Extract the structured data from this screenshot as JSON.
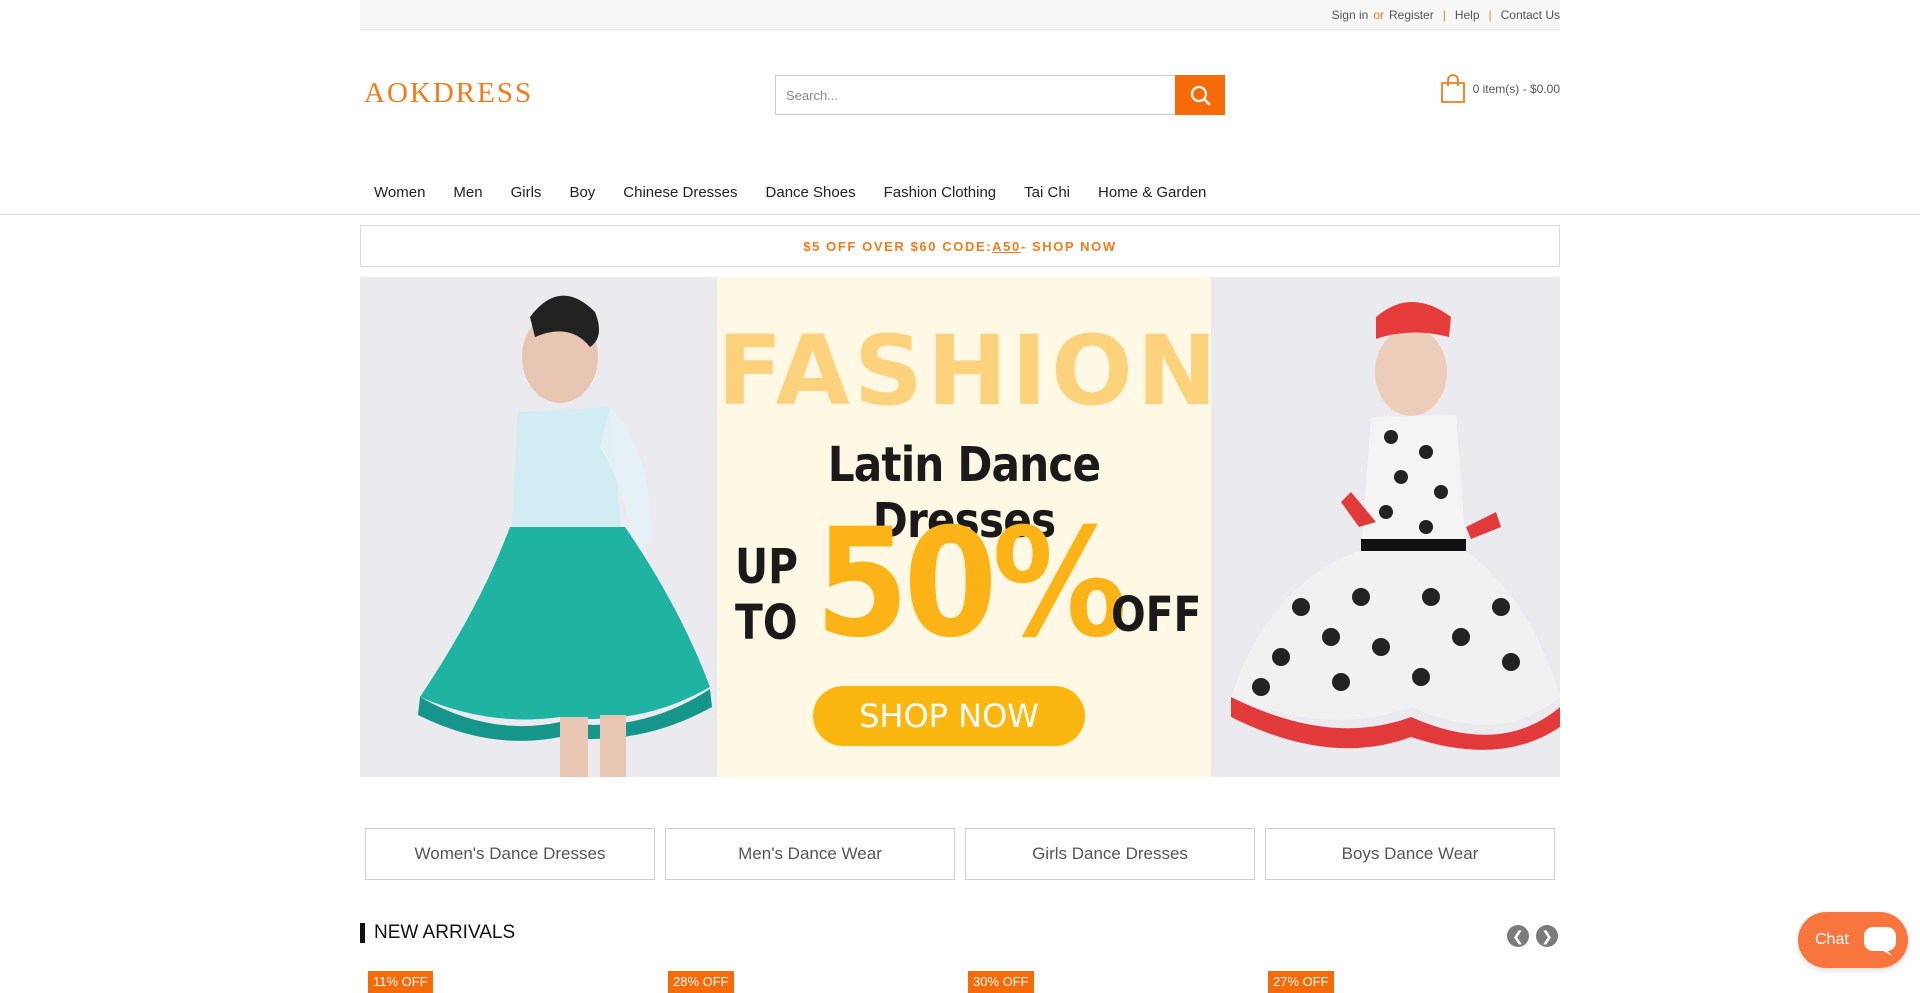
{
  "topbar": {
    "sign_in": "Sign in",
    "or": "or",
    "register": "Register",
    "sep1": "|",
    "help": "Help",
    "sep2": "|",
    "contact": "Contact Us"
  },
  "header": {
    "logo": "AOKDRESS",
    "search_placeholder": "Search...",
    "cart_text": "0 item(s) - $0.00"
  },
  "nav": {
    "items": [
      "Women",
      "Men",
      "Girls",
      "Boy",
      "Chinese Dresses",
      "Dance Shoes",
      "Fashion Clothing",
      "Tai Chi",
      "Home & Garden"
    ]
  },
  "promo": {
    "prefix": "$5 OFF OVER $60 CODE: ",
    "code": "A50",
    "suffix": " - SHOP NOW"
  },
  "banner": {
    "headline": "FASHION",
    "subtitle": "Latin Dance Dresses",
    "up": "UP",
    "to": "TO",
    "discount": "50%",
    "off": "OFF",
    "cta": "SHOP NOW"
  },
  "categories": [
    "Women's Dance Dresses",
    "Men's Dance Wear",
    "Girls Dance Dresses",
    "Boys Dance Wear"
  ],
  "new_arrivals": {
    "title": "NEW ARRIVALS",
    "badges": [
      "11% OFF",
      "28% OFF",
      "30% OFF",
      "27% OFF"
    ]
  },
  "chat": {
    "label": "Chat"
  },
  "colors": {
    "accent": "#f56b0a",
    "banner_yellow": "#fbb317"
  }
}
